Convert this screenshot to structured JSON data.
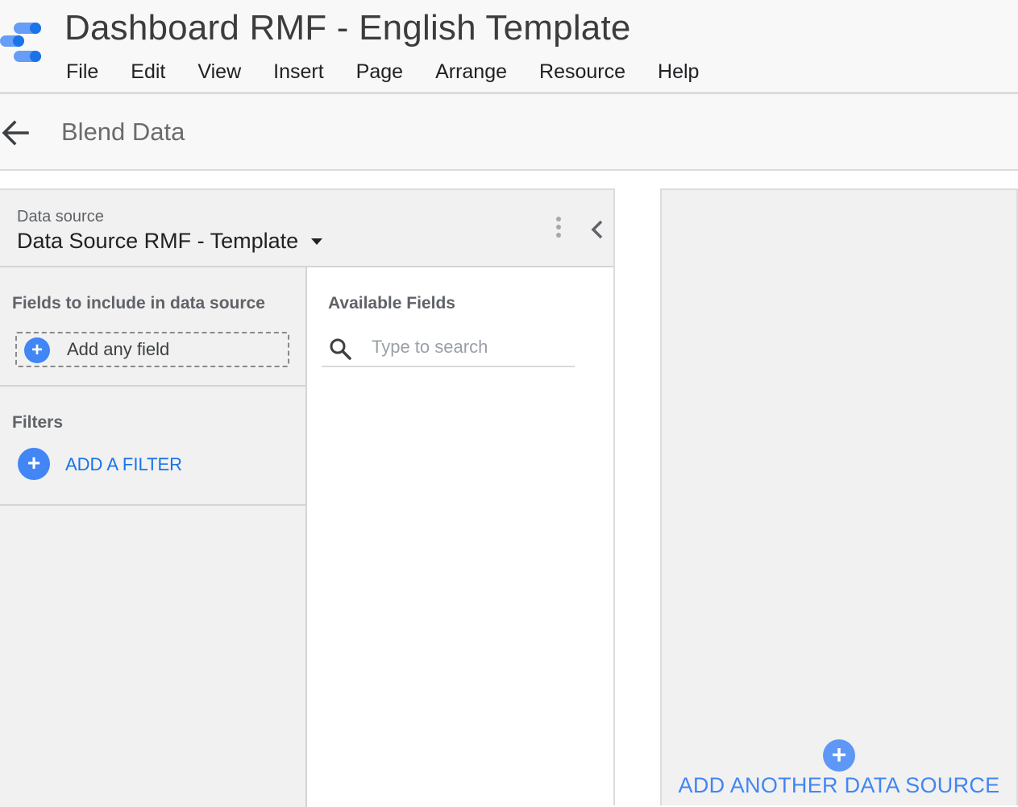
{
  "app": {
    "title": "Dashboard RMF - English Template",
    "logo_icon": "data-studio-logo",
    "menu": [
      "File",
      "Edit",
      "View",
      "Insert",
      "Page",
      "Arrange",
      "Resource",
      "Help"
    ]
  },
  "subheader": {
    "back_icon": "arrow-left-icon",
    "title": "Blend Data"
  },
  "data_source_card": {
    "label": "Data source",
    "selected": "Data Source RMF - Template",
    "more_icon": "more-vert-icon",
    "collapse_icon": "chevron-left-icon",
    "fields_section": {
      "heading": "Fields to include in data source",
      "add_field_label": "Add any field"
    },
    "filters_section": {
      "heading": "Filters",
      "add_filter_label": "ADD A FILTER"
    },
    "available_fields": {
      "heading": "Available Fields",
      "search_placeholder": "Type to search",
      "search_value": ""
    }
  },
  "add_another": {
    "label": "ADD ANOTHER DATA SOURCE"
  },
  "colors": {
    "accent": "#4285f4",
    "link": "#1a73e8",
    "panel_bg": "#f1f1f1",
    "header_bg": "#f8f8f8"
  }
}
